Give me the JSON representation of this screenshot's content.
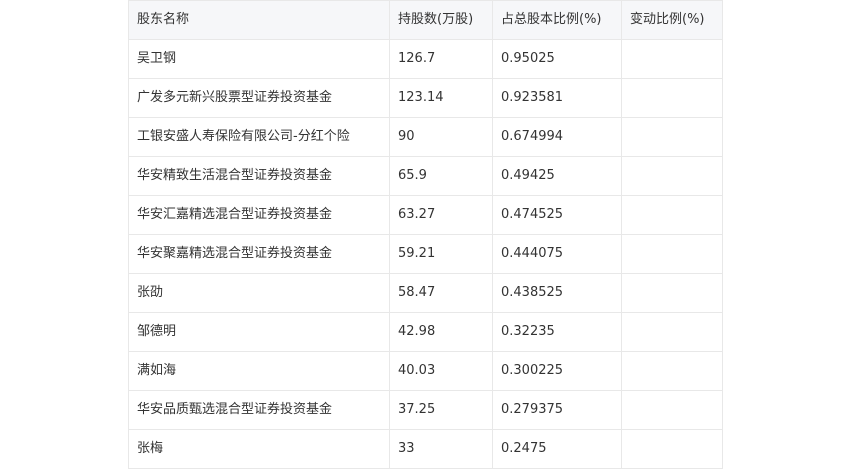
{
  "table": {
    "headers": [
      "股东名称",
      "持股数(万股)",
      "占总股本比例(%)",
      "变动比例(%)"
    ],
    "rows": [
      [
        "吴卫钢",
        "126.7",
        "0.95025",
        ""
      ],
      [
        "广发多元新兴股票型证券投资基金",
        "123.14",
        "0.923581",
        ""
      ],
      [
        "工银安盛人寿保险有限公司-分红个险",
        "90",
        "0.674994",
        ""
      ],
      [
        "华安精致生活混合型证券投资基金",
        "65.9",
        "0.49425",
        ""
      ],
      [
        "华安汇嘉精选混合型证券投资基金",
        "63.27",
        "0.474525",
        ""
      ],
      [
        "华安聚嘉精选混合型证券投资基金",
        "59.21",
        "0.444075",
        ""
      ],
      [
        "张劭",
        "58.47",
        "0.438525",
        ""
      ],
      [
        "邹德明",
        "42.98",
        "0.32235",
        ""
      ],
      [
        "满如海",
        "40.03",
        "0.300225",
        ""
      ],
      [
        "华安品质甄选混合型证券投资基金",
        "37.25",
        "0.279375",
        ""
      ],
      [
        "张梅",
        "33",
        "0.2475",
        ""
      ]
    ]
  }
}
